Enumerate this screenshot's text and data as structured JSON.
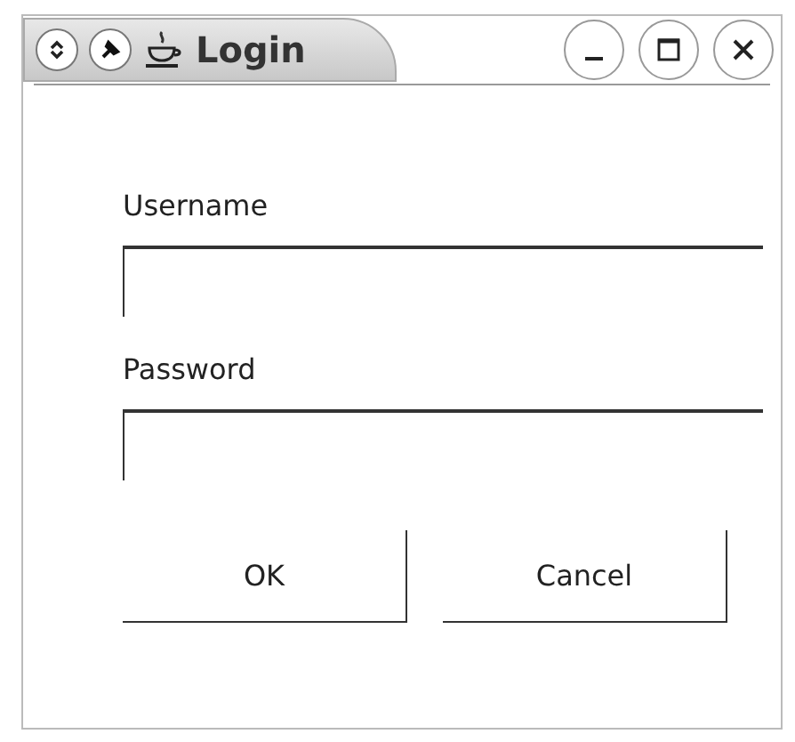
{
  "window": {
    "title": "Login"
  },
  "fields": [
    {
      "label": "Username"
    },
    {
      "label": "Password"
    }
  ],
  "buttons": [
    "OK",
    "Cancel"
  ]
}
